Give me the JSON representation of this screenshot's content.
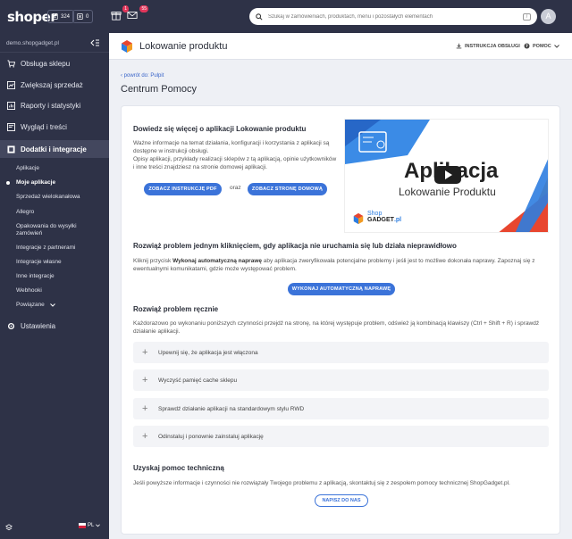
{
  "topbar": {
    "logo": "shoper",
    "chip1_count": "324",
    "chip2_count": "0",
    "gift_badge": "1",
    "mail_badge": "55",
    "search_placeholder": "Szukaj w zamówieniach, produktach, menu i pozostałych elementach",
    "search_shortcut": "/",
    "avatar_initial": "A"
  },
  "sidebar": {
    "store_name": "demo.shopgadget.pl",
    "items": [
      {
        "label": "Obsługa sklepu",
        "icon": "cart-icon"
      },
      {
        "label": "Zwiększaj sprzedaż",
        "icon": "chart-up-icon"
      },
      {
        "label": "Raporty i statystyki",
        "icon": "report-icon"
      },
      {
        "label": "Wygląd i treści",
        "icon": "palette-icon"
      },
      {
        "label": "Dodatki i integracje",
        "icon": "puzzle-icon"
      },
      {
        "label": "Ustawienia",
        "icon": "gear-icon"
      }
    ],
    "subitems": [
      "Aplikacje",
      "Moje aplikacje",
      "Sprzedaż wielokanałowa",
      "Allegro",
      "Opakowania do wysyłki zamówień",
      "Integracje z partnerami",
      "Integracje własne",
      "Inne integracje",
      "Webhooki",
      "Powiązane"
    ],
    "language": "PL"
  },
  "header": {
    "title": "Lokowanie produktu",
    "instruction_link": "INSTRUKCJA OBSŁUGI",
    "help_link": "POMOC"
  },
  "main": {
    "back_link": "powrót do: Pulpit",
    "page_title": "Centrum Pomocy",
    "intro": {
      "title": "Dowiedz się więcej o aplikacji Lokowanie produktu",
      "p1": "Ważne informacje na temat działania, konfiguracji i korzystania z aplikacji są dostępne w instrukcji obsługi.",
      "p2": "Opisy aplikacji, przykłady realizacji sklepów z tą aplikacją, opinie użytkowników i inne treści znajdziesz na stronie domowej aplikacji.",
      "btn_pdf": "ZOBACZ INSTRUKCJĘ PDF",
      "or": "oraz",
      "btn_home": "ZOBACZ STRONĘ DOMOWĄ"
    },
    "video": {
      "title_big": "Aplikacja",
      "title_small": "Lokowanie Produktu",
      "brand_top": "Shop",
      "brand_bottom": "GADGET",
      "brand_suffix": ".pl"
    },
    "auto_fix": {
      "title": "Rozwiąż problem jednym kliknięciem, gdy aplikacja nie uruchamia się lub działa nieprawidłowo",
      "text_pre": "Kliknij przycisk ",
      "text_bold": "Wykonaj automatyczną naprawę",
      "text_post": " aby aplikacja zweryfikowała potencjalne problemy i jeśli jest to możliwe dokonała naprawy. Zapoznaj się z ewentualnymi komunikatami, gdzie może występować problem.",
      "button": "WYKONAJ AUTOMATYCZNĄ NAPRAWĘ"
    },
    "manual_fix": {
      "title": "Rozwiąż problem ręcznie",
      "text": "Każdorazowo po wykonaniu poniższych czynności przejdź na stronę, na której występuje problem, odśwież ją kombinacją klawiszy (Ctrl + Shift + R) i sprawdź działanie aplikacji.",
      "steps": [
        "Upewnij się, że aplikacja jest włączona",
        "Wyczyść pamięć cache sklepu",
        "Sprawdź działanie aplikacji na standardowym stylu RWD",
        "Odinstaluj i ponownie zainstaluj aplikację"
      ]
    },
    "support": {
      "title": "Uzyskaj pomoc techniczną",
      "text": "Jeśli powyższe informacje i czynności nie rozwiązały Twojego problemu z aplikacją, skontaktuj się z zespołem pomocy technicznej ShopGadget.pl.",
      "button": "NAPISZ DO NAS"
    }
  }
}
